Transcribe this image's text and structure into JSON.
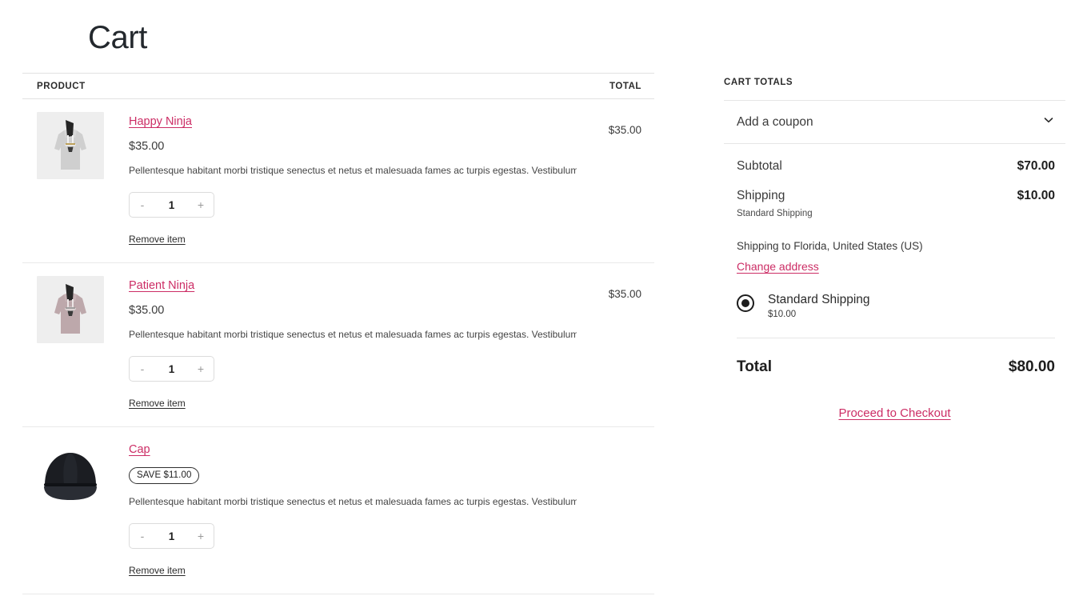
{
  "page": {
    "title": "Cart"
  },
  "table": {
    "col_product": "PRODUCT",
    "col_total": "TOTAL"
  },
  "items": [
    {
      "name": "Happy Ninja",
      "price": "$35.00",
      "description": "Pellentesque habitant morbi tristique senectus et netus et malesuada fames ac turpis egestas. Vestibulum tortor...",
      "quantity": "1",
      "decrement_label": "-",
      "increment_label": "+",
      "remove_label": "Remove item",
      "line_total": "$35.00",
      "badge": "",
      "thumb_type": "hoodie-grey"
    },
    {
      "name": "Patient Ninja",
      "price": "$35.00",
      "description": "Pellentesque habitant morbi tristique senectus et netus et malesuada fames ac turpis egestas. Vestibulum tortor...",
      "quantity": "1",
      "decrement_label": "-",
      "increment_label": "+",
      "remove_label": "Remove item",
      "line_total": "$35.00",
      "badge": "",
      "thumb_type": "hoodie-mauve"
    },
    {
      "name": "Cap",
      "price": "",
      "description": "Pellentesque habitant morbi tristique senectus et netus et malesuada fames ac turpis egestas. Vestibulum tortor...",
      "quantity": "1",
      "decrement_label": "-",
      "increment_label": "+",
      "remove_label": "Remove item",
      "line_total": "",
      "badge": "SAVE $11.00",
      "thumb_type": "cap-black"
    }
  ],
  "totals": {
    "heading": "CART TOTALS",
    "coupon_label": "Add a coupon",
    "coupon_icon": "chevron-down-icon",
    "subtotal_label": "Subtotal",
    "subtotal_value": "$70.00",
    "shipping_label": "Shipping",
    "shipping_value": "$10.00",
    "shipping_method_note": "Standard Shipping",
    "shipping_to": "Shipping to Florida, United States (US)",
    "change_address_label": "Change address",
    "shipping_option_name": "Standard Shipping",
    "shipping_option_price": "$10.00",
    "total_label": "Total",
    "total_value": "$80.00",
    "checkout_label": "Proceed to Checkout"
  },
  "colors": {
    "link": "#cc2d65",
    "text": "#2b2b2b",
    "border": "#e6e6e6"
  }
}
